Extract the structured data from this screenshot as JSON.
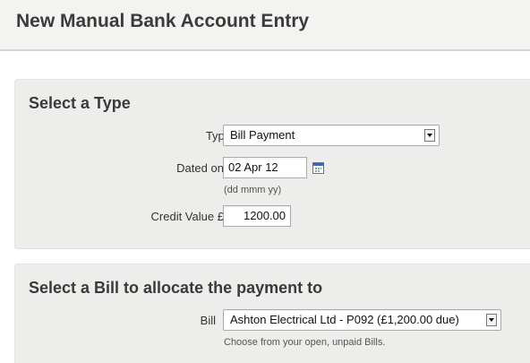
{
  "page": {
    "title": "New Manual Bank Account Entry"
  },
  "type_section": {
    "heading": "Select a Type",
    "type_label": "Type",
    "type_value": "Bill Payment",
    "dated_label": "Dated on",
    "required_mark": "*",
    "dated_value": "02 Apr 12",
    "date_hint": "(dd mmm yy)",
    "credit_label": "Credit Value £",
    "credit_value": "1200.00",
    "icons": {
      "calendar": "calendar-icon",
      "dropdown": "chevron-down-icon"
    }
  },
  "bill_section": {
    "heading": "Select a Bill to allocate the payment to",
    "bill_label": "Bill",
    "bill_value": "Ashton Electrical Ltd - P092 (£1,200.00 due)",
    "bill_hint": "Choose from your open, unpaid Bills."
  },
  "colors": {
    "required": "#cc1111",
    "panel_bg": "#ededeb",
    "header_bg": "#f3f3f1"
  }
}
